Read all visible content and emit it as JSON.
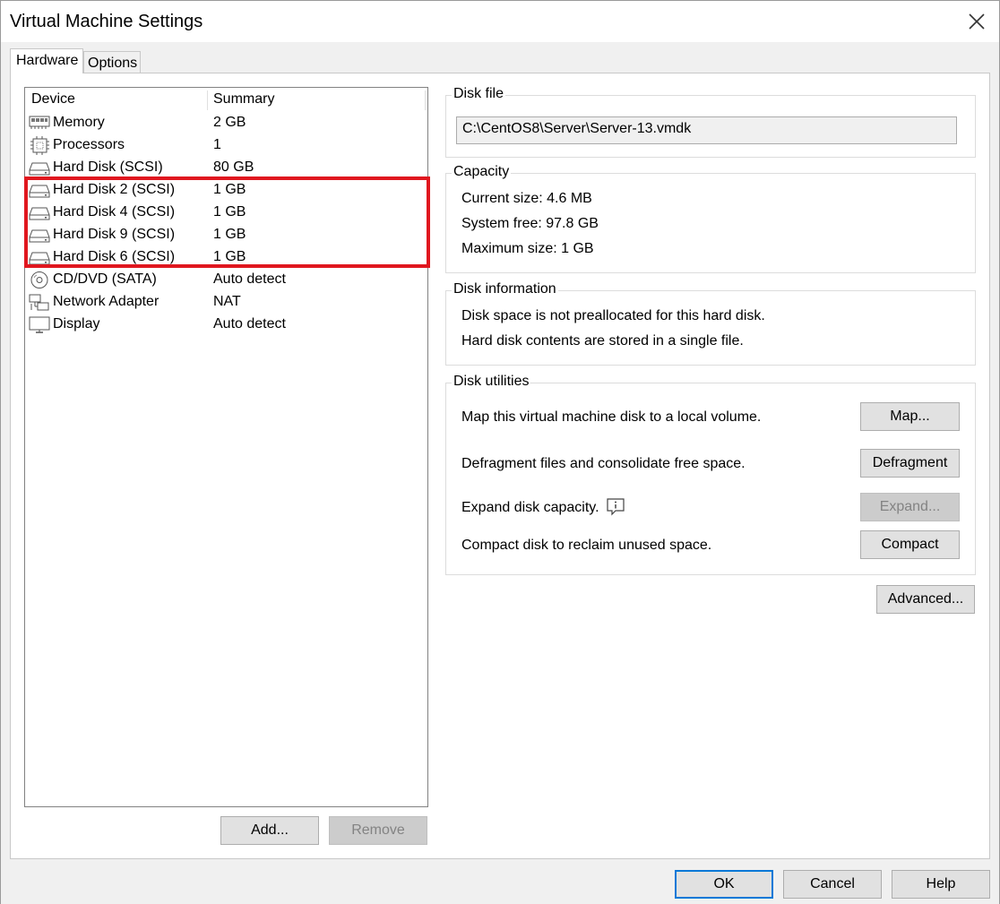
{
  "window": {
    "title": "Virtual Machine Settings"
  },
  "tabs": [
    {
      "label": "Hardware",
      "active": true
    },
    {
      "label": "Options",
      "active": false
    }
  ],
  "device_list": {
    "headers": {
      "device": "Device",
      "summary": "Summary"
    },
    "rows": [
      {
        "icon": "memory-icon",
        "device": "Memory",
        "summary": "2 GB"
      },
      {
        "icon": "processor-icon",
        "device": "Processors",
        "summary": "1"
      },
      {
        "icon": "hard-disk-icon",
        "device": "Hard Disk (SCSI)",
        "summary": "80 GB"
      },
      {
        "icon": "hard-disk-icon",
        "device": "Hard Disk 2 (SCSI)",
        "summary": "1 GB"
      },
      {
        "icon": "hard-disk-icon",
        "device": "Hard Disk 4 (SCSI)",
        "summary": "1 GB"
      },
      {
        "icon": "hard-disk-icon",
        "device": "Hard Disk 9 (SCSI)",
        "summary": "1 GB"
      },
      {
        "icon": "hard-disk-icon",
        "device": "Hard Disk 6 (SCSI)",
        "summary": "1 GB"
      },
      {
        "icon": "cd-dvd-icon",
        "device": "CD/DVD (SATA)",
        "summary": "Auto detect"
      },
      {
        "icon": "network-adapter-icon",
        "device": "Network Adapter",
        "summary": "NAT"
      },
      {
        "icon": "display-icon",
        "device": "Display",
        "summary": "Auto detect"
      }
    ],
    "highlight_color": "#e0171f"
  },
  "list_buttons": {
    "add": "Add...",
    "remove": "Remove"
  },
  "disk_file": {
    "label": "Disk file",
    "path": "C:\\CentOS8\\Server\\Server-13.vmdk"
  },
  "capacity": {
    "label": "Capacity",
    "current_size": "Current size: 4.6 MB",
    "system_free": "System free: 97.8 GB",
    "maximum_size": "Maximum size: 1 GB"
  },
  "disk_information": {
    "label": "Disk information",
    "line1": "Disk space is not preallocated for this hard disk.",
    "line2": "Hard disk contents are stored in a single file."
  },
  "disk_utilities": {
    "label": "Disk utilities",
    "map_text": "Map this virtual machine disk to a local volume.",
    "map_button": "Map...",
    "defrag_text": "Defragment files and consolidate free space.",
    "defrag_button": "Defragment",
    "expand_text": "Expand disk capacity.",
    "expand_button": "Expand...",
    "compact_text": "Compact disk to reclaim unused space.",
    "compact_button": "Compact"
  },
  "advanced_button": "Advanced...",
  "footer": {
    "ok": "OK",
    "cancel": "Cancel",
    "help": "Help"
  },
  "colors": {
    "window_bg": "#f0f0f0",
    "panel_bg": "#ffffff",
    "default_button_border": "#0078d7"
  }
}
